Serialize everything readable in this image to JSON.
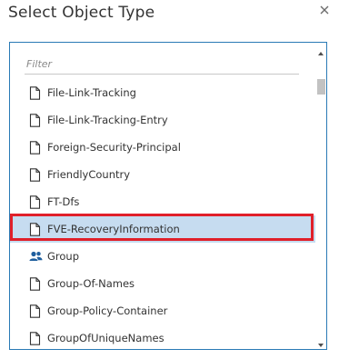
{
  "dialog": {
    "title": "Select Object Type",
    "close_icon": "close-icon"
  },
  "filter": {
    "placeholder": "Filter",
    "value": ""
  },
  "items": [
    {
      "label": "File-Link-Tracking",
      "icon": "document-icon",
      "selected": false
    },
    {
      "label": "File-Link-Tracking-Entry",
      "icon": "document-icon",
      "selected": false
    },
    {
      "label": "Foreign-Security-Principal",
      "icon": "document-icon",
      "selected": false
    },
    {
      "label": "FriendlyCountry",
      "icon": "document-icon",
      "selected": false
    },
    {
      "label": "FT-Dfs",
      "icon": "document-icon",
      "selected": false
    },
    {
      "label": "FVE-RecoveryInformation",
      "icon": "document-icon",
      "selected": true
    },
    {
      "label": "Group",
      "icon": "group-icon",
      "selected": false
    },
    {
      "label": "Group-Of-Names",
      "icon": "document-icon",
      "selected": false
    },
    {
      "label": "Group-Policy-Container",
      "icon": "document-icon",
      "selected": false
    },
    {
      "label": "GroupOfUniqueNames",
      "icon": "document-icon",
      "selected": false
    }
  ],
  "colors": {
    "selection_fill": "#c6dcf0",
    "highlight_ring": "#e0202a",
    "group_icon": "#1f5f9e",
    "list_border": "#2a7ab5"
  }
}
